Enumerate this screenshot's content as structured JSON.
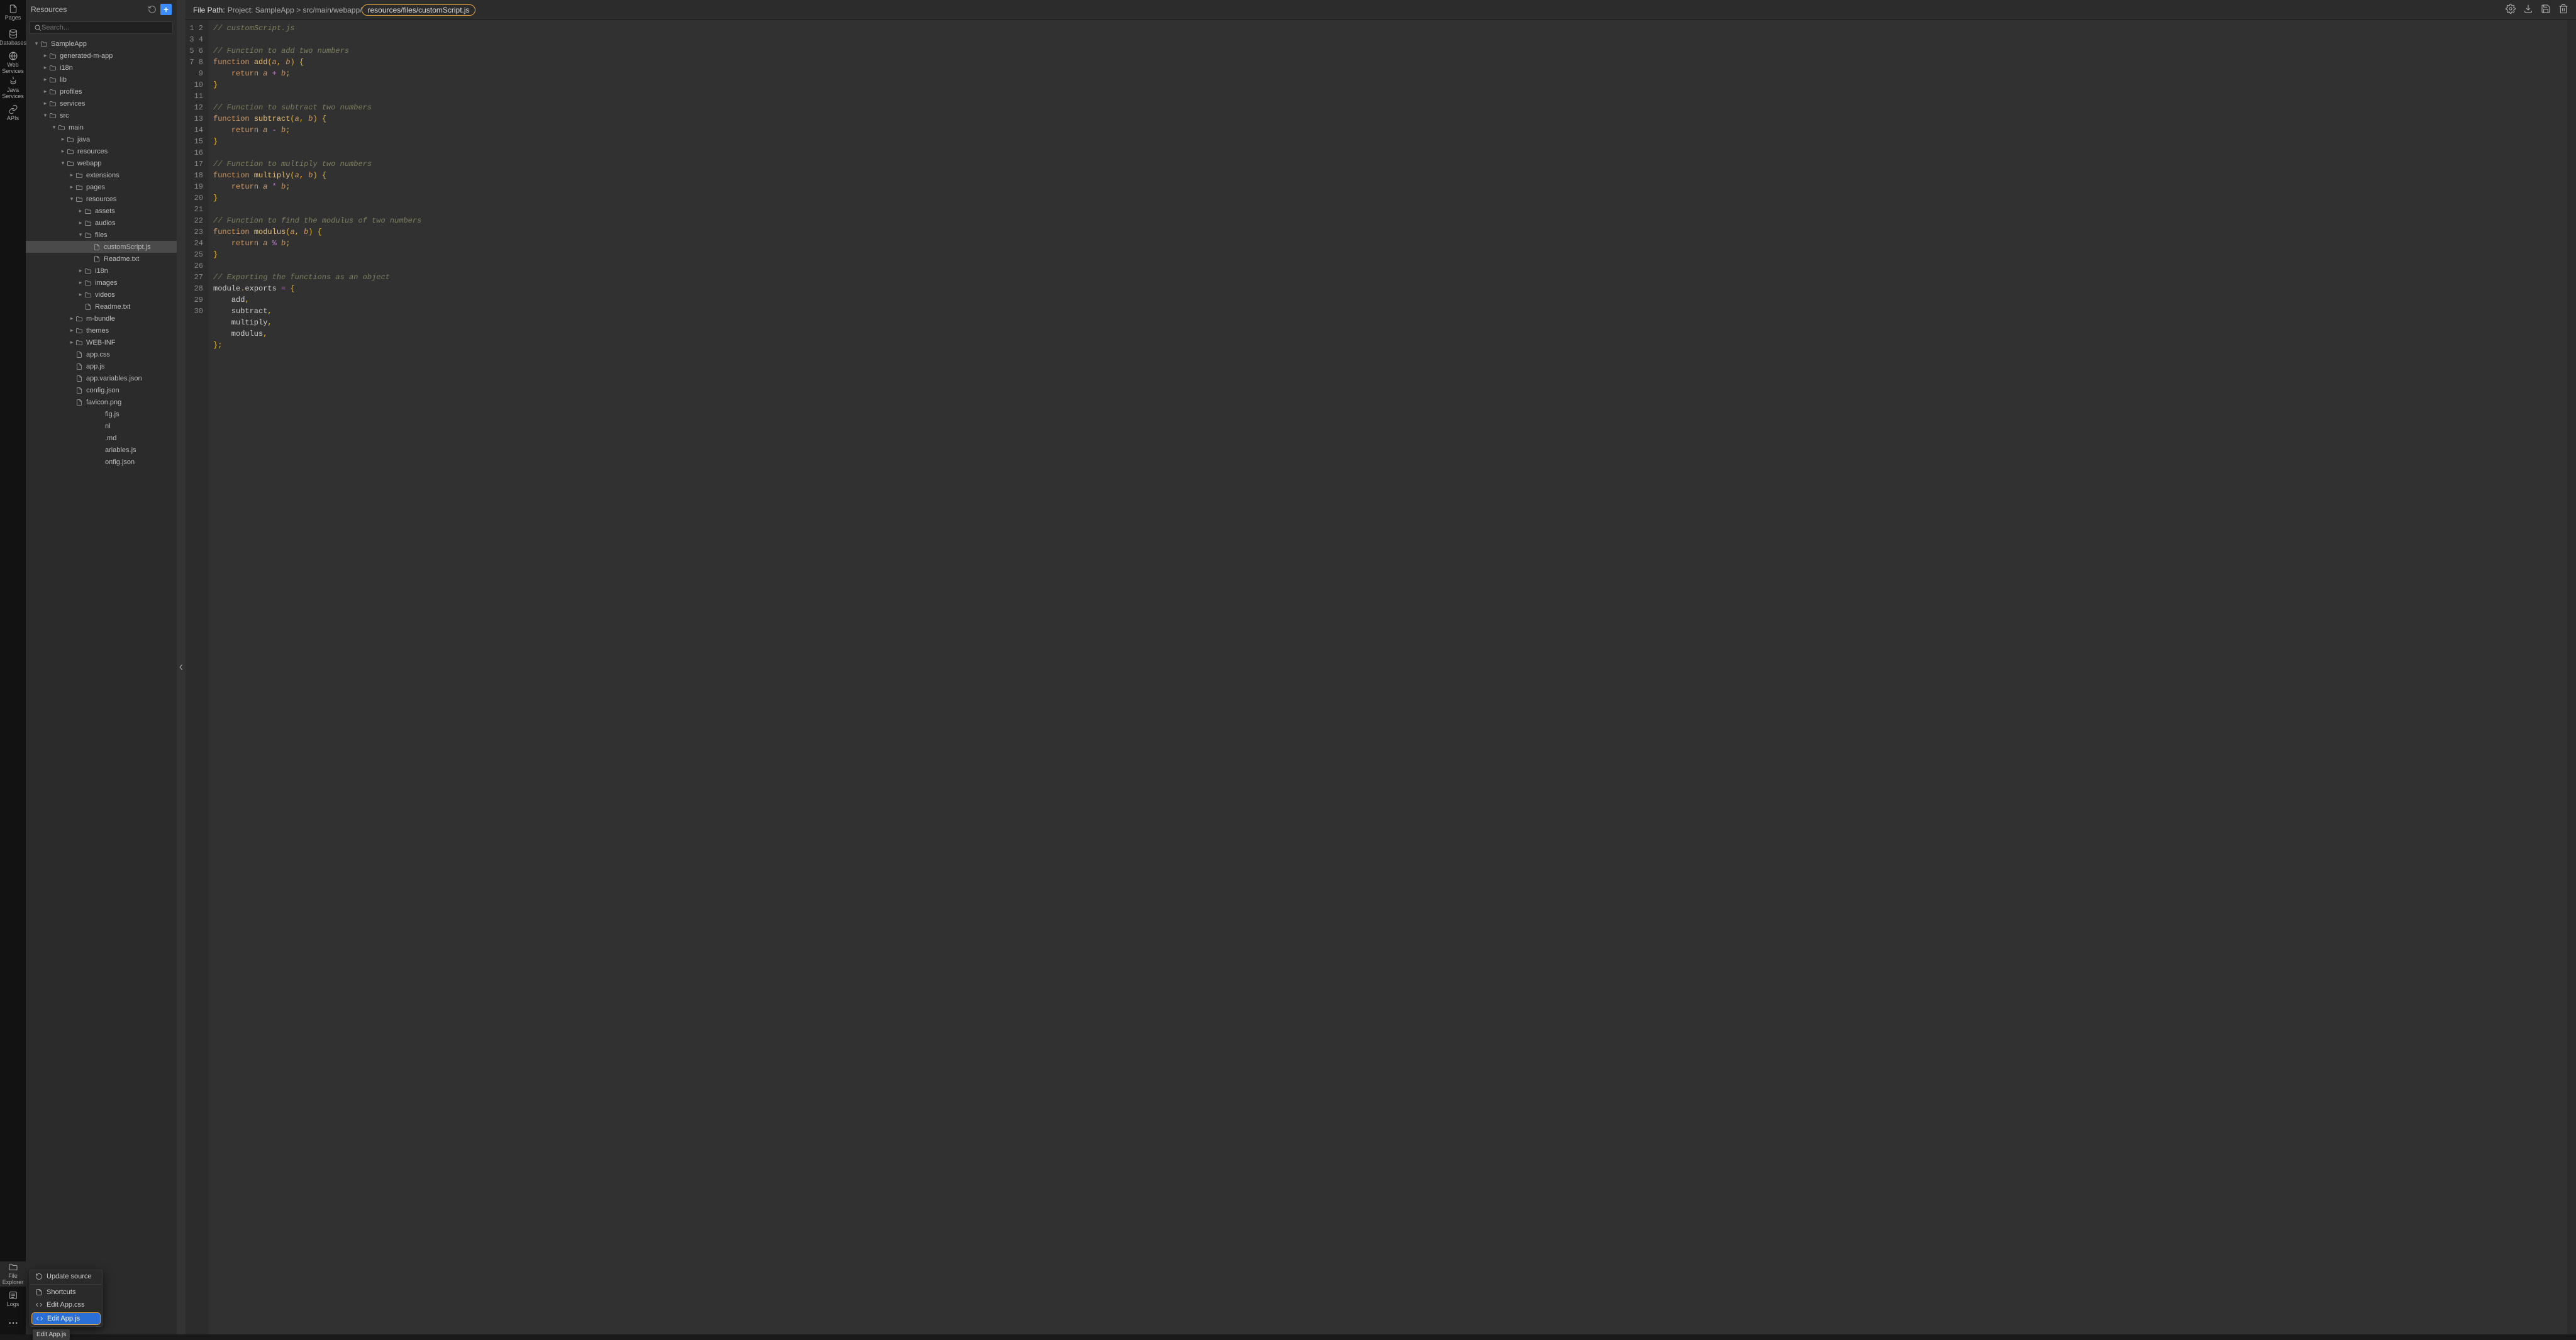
{
  "rail": {
    "items": [
      {
        "name": "pages",
        "label": "Pages",
        "active": false
      },
      {
        "name": "databases",
        "label": "Databases",
        "active": false
      },
      {
        "name": "web-services",
        "label": "Web\nServices",
        "active": false
      },
      {
        "name": "java-services",
        "label": "Java\nServices",
        "active": false
      },
      {
        "name": "apis",
        "label": "APIs",
        "active": false
      }
    ],
    "bottom": [
      {
        "name": "file-explorer",
        "label": "File\nExplorer",
        "active": true
      },
      {
        "name": "logs",
        "label": "Logs",
        "active": false
      }
    ]
  },
  "explorer": {
    "title": "Resources",
    "search_placeholder": "Search...",
    "tree": [
      {
        "depth": 0,
        "expanded": true,
        "kind": "folder",
        "label": "SampleApp",
        "selected": false
      },
      {
        "depth": 1,
        "expanded": false,
        "kind": "folder",
        "label": "generated-m-app"
      },
      {
        "depth": 1,
        "expanded": false,
        "kind": "folder",
        "label": "i18n"
      },
      {
        "depth": 1,
        "expanded": false,
        "kind": "folder",
        "label": "lib"
      },
      {
        "depth": 1,
        "expanded": false,
        "kind": "folder",
        "label": "profiles"
      },
      {
        "depth": 1,
        "expanded": false,
        "kind": "folder",
        "label": "services"
      },
      {
        "depth": 1,
        "expanded": true,
        "kind": "folder",
        "label": "src"
      },
      {
        "depth": 2,
        "expanded": true,
        "kind": "folder",
        "label": "main"
      },
      {
        "depth": 3,
        "expanded": false,
        "kind": "folder",
        "label": "java"
      },
      {
        "depth": 3,
        "expanded": false,
        "kind": "folder",
        "label": "resources"
      },
      {
        "depth": 3,
        "expanded": true,
        "kind": "folder",
        "label": "webapp"
      },
      {
        "depth": 4,
        "expanded": false,
        "kind": "folder",
        "label": "extensions"
      },
      {
        "depth": 4,
        "expanded": false,
        "kind": "folder",
        "label": "pages"
      },
      {
        "depth": 4,
        "expanded": true,
        "kind": "folder",
        "label": "resources"
      },
      {
        "depth": 5,
        "expanded": false,
        "kind": "folder",
        "label": "assets"
      },
      {
        "depth": 5,
        "expanded": false,
        "kind": "folder",
        "label": "audios"
      },
      {
        "depth": 5,
        "expanded": true,
        "kind": "folder",
        "label": "files"
      },
      {
        "depth": 6,
        "expanded": null,
        "kind": "file",
        "label": "customScript.js",
        "selected": true
      },
      {
        "depth": 6,
        "expanded": null,
        "kind": "file",
        "label": "Readme.txt"
      },
      {
        "depth": 5,
        "expanded": false,
        "kind": "folder",
        "label": "i18n"
      },
      {
        "depth": 5,
        "expanded": false,
        "kind": "folder",
        "label": "images"
      },
      {
        "depth": 5,
        "expanded": false,
        "kind": "folder",
        "label": "videos"
      },
      {
        "depth": 5,
        "expanded": null,
        "kind": "file",
        "label": "Readme.txt"
      },
      {
        "depth": 4,
        "expanded": false,
        "kind": "folder",
        "label": "m-bundle"
      },
      {
        "depth": 4,
        "expanded": false,
        "kind": "folder",
        "label": "themes"
      },
      {
        "depth": 4,
        "expanded": false,
        "kind": "folder",
        "label": "WEB-INF"
      },
      {
        "depth": 4,
        "expanded": null,
        "kind": "file",
        "label": "app.css"
      },
      {
        "depth": 4,
        "expanded": null,
        "kind": "file",
        "label": "app.js"
      },
      {
        "depth": 4,
        "expanded": null,
        "kind": "file",
        "label": "app.variables.json"
      },
      {
        "depth": 4,
        "expanded": null,
        "kind": "file",
        "label": "config.json"
      },
      {
        "depth": 4,
        "expanded": null,
        "kind": "file",
        "label": "favicon.png"
      },
      {
        "depth": 4,
        "expanded": null,
        "kind": "file",
        "label": "fig.js",
        "truncated": true
      },
      {
        "depth": 4,
        "expanded": null,
        "kind": "file",
        "label": "nl",
        "truncated": true
      },
      {
        "depth": 4,
        "expanded": null,
        "kind": "file",
        "label": ".md",
        "truncated": true
      },
      {
        "depth": 4,
        "expanded": null,
        "kind": "file",
        "label": "ariables.js",
        "truncated": true
      },
      {
        "depth": 4,
        "expanded": null,
        "kind": "file",
        "label": "onfig.json",
        "truncated": true
      }
    ]
  },
  "popup": {
    "items": [
      {
        "label": "Update source",
        "icon": "refresh"
      },
      {
        "label": "Shortcuts",
        "icon": "file"
      },
      {
        "label": "Edit App.css",
        "icon": "code"
      },
      {
        "label": "Edit App.js",
        "icon": "code",
        "highlighted": true
      }
    ],
    "tooltip": "Edit App.js"
  },
  "pathbar": {
    "label": "File Path:",
    "prefix": "Project: SampleApp > src/main/webapp/",
    "highlighted": "resources/files/customScript.js"
  },
  "code": {
    "line_count": 30,
    "lines": [
      {
        "t": "comment",
        "s": "// customScript.js"
      },
      {
        "t": "blank",
        "s": ""
      },
      {
        "t": "comment",
        "s": "// Function to add two numbers"
      },
      {
        "t": "fn",
        "kw": "function",
        "name": "add",
        "pa": "a",
        "pb": "b"
      },
      {
        "t": "ret",
        "op": "+"
      },
      {
        "t": "close",
        "s": "}"
      },
      {
        "t": "blank",
        "s": ""
      },
      {
        "t": "comment",
        "s": "// Function to subtract two numbers"
      },
      {
        "t": "fn",
        "kw": "function",
        "name": "subtract",
        "pa": "a",
        "pb": "b"
      },
      {
        "t": "ret",
        "op": "-"
      },
      {
        "t": "close",
        "s": "}"
      },
      {
        "t": "blank",
        "s": ""
      },
      {
        "t": "comment",
        "s": "// Function to multiply two numbers"
      },
      {
        "t": "fn",
        "kw": "function",
        "name": "multiply",
        "pa": "a",
        "pb": "b"
      },
      {
        "t": "ret",
        "op": "*"
      },
      {
        "t": "close",
        "s": "}"
      },
      {
        "t": "blank",
        "s": ""
      },
      {
        "t": "comment",
        "s": "// Function to find the modulus of two numbers"
      },
      {
        "t": "fn",
        "kw": "function",
        "name": "modulus",
        "pa": "a",
        "pb": "b"
      },
      {
        "t": "ret",
        "op": "%"
      },
      {
        "t": "close",
        "s": "}"
      },
      {
        "t": "blank",
        "s": ""
      },
      {
        "t": "comment",
        "s": "// Exporting the functions as an object"
      },
      {
        "t": "plain",
        "s": "module.exports = {",
        "export": true
      },
      {
        "t": "plain",
        "s": "    add,"
      },
      {
        "t": "plain",
        "s": "    subtract,"
      },
      {
        "t": "plain",
        "s": "    multiply,"
      },
      {
        "t": "plain",
        "s": "    modulus,"
      },
      {
        "t": "plain",
        "s": "};"
      },
      {
        "t": "blank",
        "s": ""
      }
    ]
  }
}
